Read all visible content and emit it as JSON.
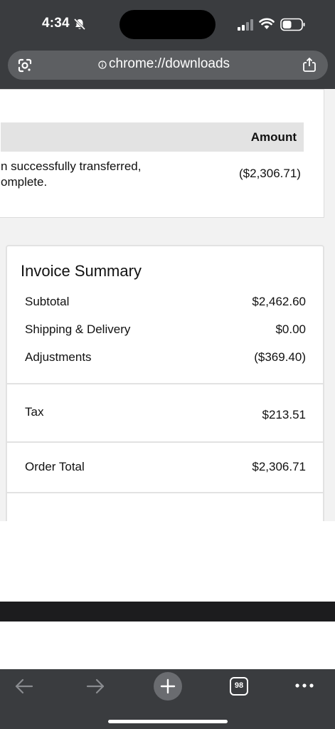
{
  "status_bar": {
    "time": "4:34"
  },
  "browser": {
    "url": "chrome://downloads"
  },
  "table": {
    "amount_header": "Amount",
    "description_line1": "n successfully transferred,",
    "description_line2": "omplete.",
    "amount": "($2,306.71)"
  },
  "summary": {
    "title": "Invoice Summary",
    "rows": [
      {
        "label": "Subtotal",
        "value": "$2,462.60"
      },
      {
        "label": "Shipping & Delivery",
        "value": "$0.00"
      },
      {
        "label": "Adjustments",
        "value": "($369.40)"
      },
      {
        "label": "Tax",
        "value": "$213.51"
      },
      {
        "label": "Order Total",
        "value": "$2,306.71"
      }
    ]
  },
  "toolbar": {
    "tab_count": "98"
  },
  "icons": [
    "mute-bell-icon",
    "cellular-signal-icon",
    "wifi-icon",
    "battery-icon",
    "google-lens-icon",
    "info-icon",
    "share-icon",
    "back-arrow-icon",
    "forward-arrow-icon",
    "plus-icon",
    "tab-switcher-icon",
    "more-icon"
  ]
}
